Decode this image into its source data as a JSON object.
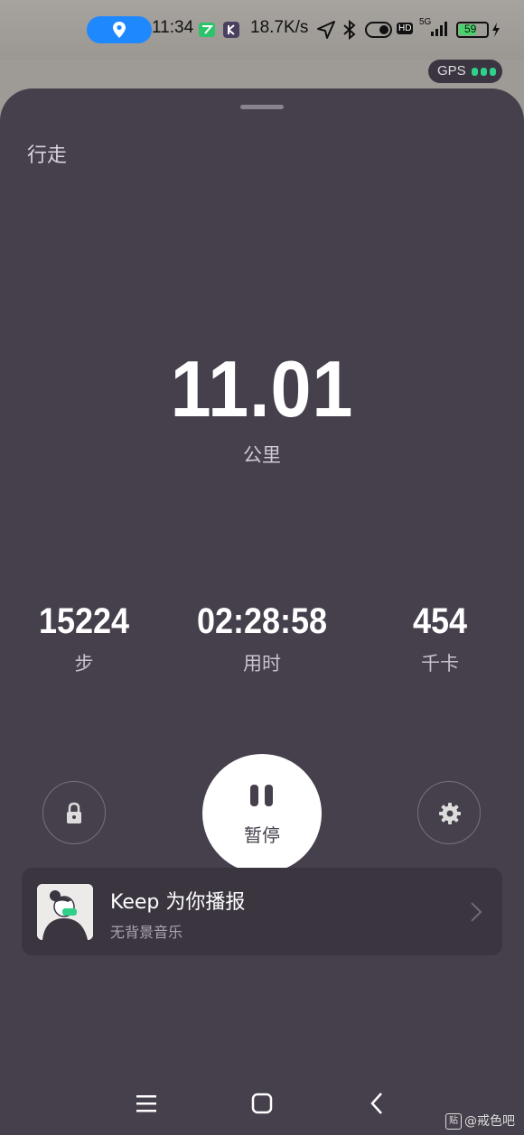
{
  "status_bar": {
    "time": "11:34",
    "net_speed": "18.7K/s",
    "battery": "59",
    "signal": "5G",
    "hd": "HD",
    "gps_label": "GPS"
  },
  "workout": {
    "mode": "行走",
    "distance": "11.01",
    "distance_unit": "公里",
    "steps": "15224",
    "steps_unit": "步",
    "duration": "02:28:58",
    "duration_unit": "用时",
    "calories": "454",
    "calories_unit": "千卡"
  },
  "controls": {
    "pause_label": "暂停",
    "lock_icon": "lock-icon",
    "settings_icon": "gear-icon"
  },
  "voice_card": {
    "title": "Keep 为你播报",
    "subtitle": "无背景音乐"
  },
  "watermark": {
    "badge": "贴",
    "text": "@戒色吧"
  },
  "colors": {
    "sheet_bg": "#463f4c",
    "card_bg": "#3b3540",
    "accent_green": "#2fd08a",
    "location_blue": "#1e88ff"
  }
}
